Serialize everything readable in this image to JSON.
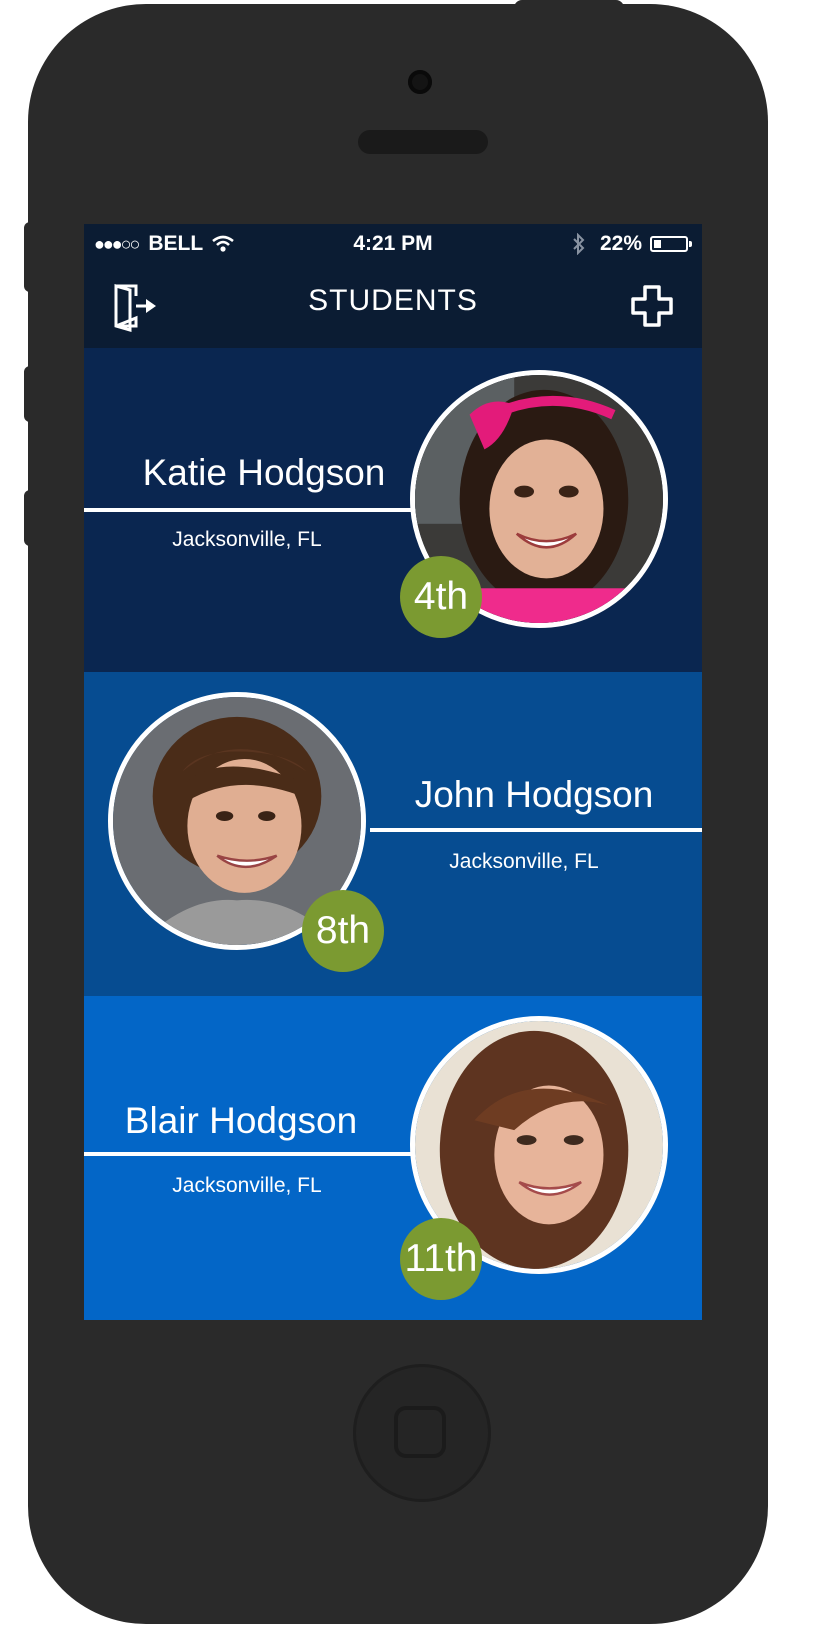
{
  "status_bar": {
    "signal": "●●●○○",
    "carrier": "BELL",
    "time": "4:21 PM",
    "battery_percent": "22%",
    "battery_level": 0.22,
    "icons": [
      "wifi-icon",
      "bluetooth-icon",
      "battery-icon"
    ]
  },
  "nav": {
    "title": "STUDENTS",
    "left_icon": "exit-door-icon",
    "right_icon": "plus-icon"
  },
  "students": [
    {
      "name": "Katie Hodgson",
      "location": "Jacksonville, FL",
      "grade": "4th",
      "bg": "#0a2650"
    },
    {
      "name": "John Hodgson",
      "location": "Jacksonville, FL",
      "grade": "8th",
      "bg": "#064c91"
    },
    {
      "name": "Blair Hodgson",
      "location": "Jacksonville, FL",
      "grade": "11th",
      "bg": "#0366c7"
    }
  ],
  "colors": {
    "nav_bg": "#0b1c33",
    "grade_badge": "#7b9a31",
    "phone_body": "#2a2a2a"
  }
}
